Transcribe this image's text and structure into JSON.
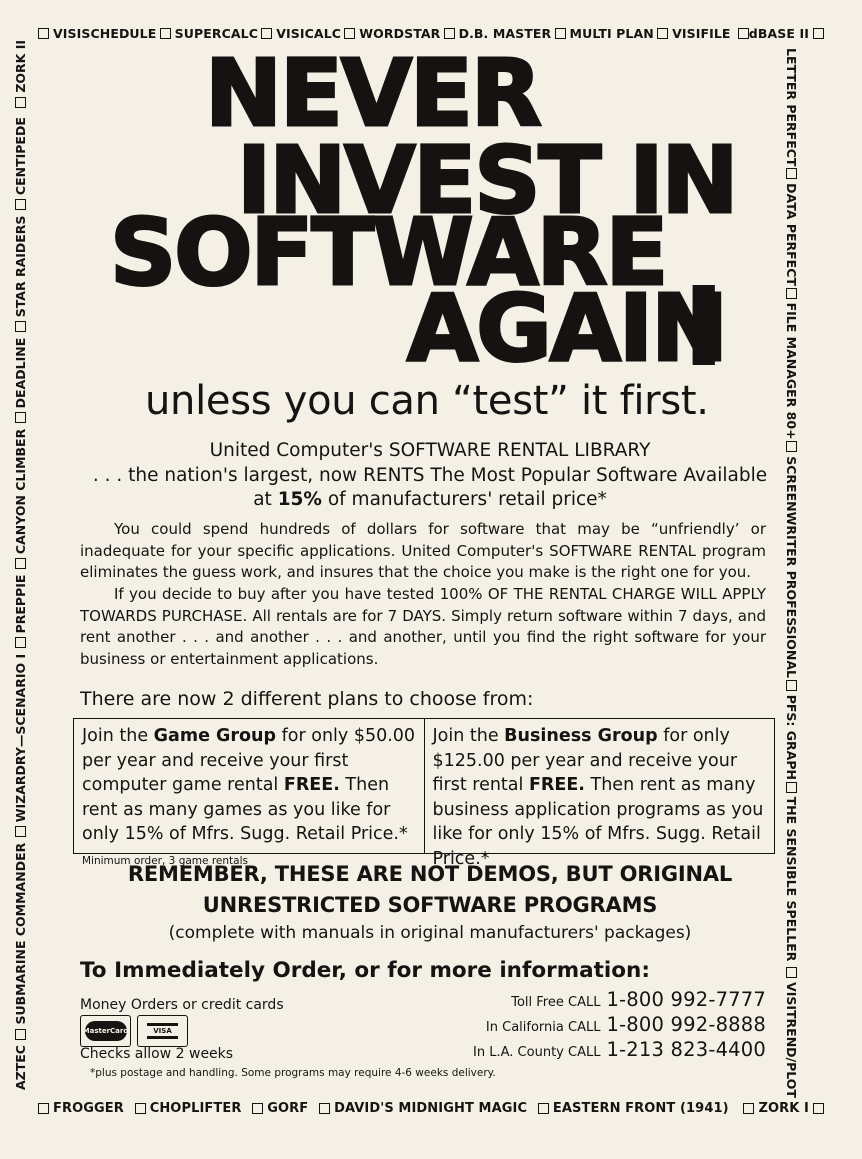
{
  "border_top": [
    "VISISCHEDULE",
    "SUPERCALC",
    "VISICALC",
    "WORDSTAR",
    "D.B. MASTER",
    "MULTI PLAN",
    "VISIFILE",
    "dBASE II"
  ],
  "border_bottom": [
    "FROGGER",
    "CHOPLIFTER",
    "GORF",
    "DAVID'S MIDNIGHT MAGIC",
    "EASTERN FRONT (1941)",
    "ZORK I"
  ],
  "border_left": [
    "AZTEC",
    "SUBMARINE COMMANDER",
    "WIZARDRY—SCENARIO I",
    "PREPPIE",
    "CANYON CLIMBER",
    "DEADLINE",
    "STAR RAIDERS",
    "CENTIPEDE",
    "ZORK II"
  ],
  "border_right": [
    "LETTER PERFECT",
    "DATA PERFECT",
    "FILE MANAGER 80+",
    "SCREENWRITER PROFESSIONAL",
    "PFS: GRAPH",
    "THE SENSIBLE SPELLER",
    "VISITREND/PLOT"
  ],
  "headline": {
    "line1": "NEVER",
    "line2": "INVEST IN",
    "line3": "SOFTWARE",
    "line4": "AGAIN",
    "exclaim": "!"
  },
  "subheadline": "unless you can “test” it first.",
  "rental": {
    "line1": "United Computer's SOFTWARE RENTAL LIBRARY",
    "line2": ". . . the nation's largest, now RENTS The Most Popular Software Available",
    "line3_prefix": "at ",
    "line3_bold": "15%",
    "line3_suffix": " of manufacturers' retail price*"
  },
  "paragraphs": {
    "p1": "You could spend hundreds of dollars for software that may be “unfriendly’ or inadequate for your specific applications. United Computer's SOFTWARE RENTAL program eliminates the guess work, and insures that the choice you make is the right one for you.",
    "p2": "If you decide to buy after you have tested 100% OF THE RENTAL CHARGE WILL APPLY TOWARDS PURCHASE. All rentals are for 7 DAYS. Simply return software within 7 days, and rent another . . . and another . . . and another, until you find the right software for your business or entertainment applications."
  },
  "plans_title": "There are now 2 different plans to choose from:",
  "plans": {
    "game": {
      "t1": "Join the ",
      "b1": "Game Group",
      "t2": " for only $50.00 per year and receive your first computer game rental ",
      "b2": "FREE.",
      "t3": " Then rent as many games as you like for only 15% of Mfrs. Sugg. Retail Price.* ",
      "note": "Minimum order, 3 game rentals"
    },
    "business": {
      "t1": "Join the ",
      "b1": "Business Group",
      "t2": " for only $125.00 per year and receive your first rental ",
      "b2": "FREE.",
      "t3": " Then rent as many business application programs as you like for only 15% of Mfrs. Sugg. Retail Price.*"
    }
  },
  "remember": {
    "line1": "REMEMBER, THESE ARE NOT DEMOS, BUT ORIGINAL",
    "line2": "UNRESTRICTED SOFTWARE PROGRAMS",
    "line3": "(complete with manuals in original manufacturers' packages)"
  },
  "order": {
    "title": "To Immediately Order, or for more information:",
    "money": "Money Orders or credit cards",
    "mastercard": "MasterCard",
    "visa": "VISA",
    "checks": "Checks allow 2 weeks",
    "fine_print": "*plus postage and handling. Some programs may require 4-6 weeks delivery.",
    "phones": [
      {
        "label": "Toll Free CALL",
        "number": "1-800  992-7777"
      },
      {
        "label": "In California CALL",
        "number": "1-800  992-8888"
      },
      {
        "label": "In L.A. County CALL",
        "number": "1-213  823-4400"
      }
    ]
  }
}
